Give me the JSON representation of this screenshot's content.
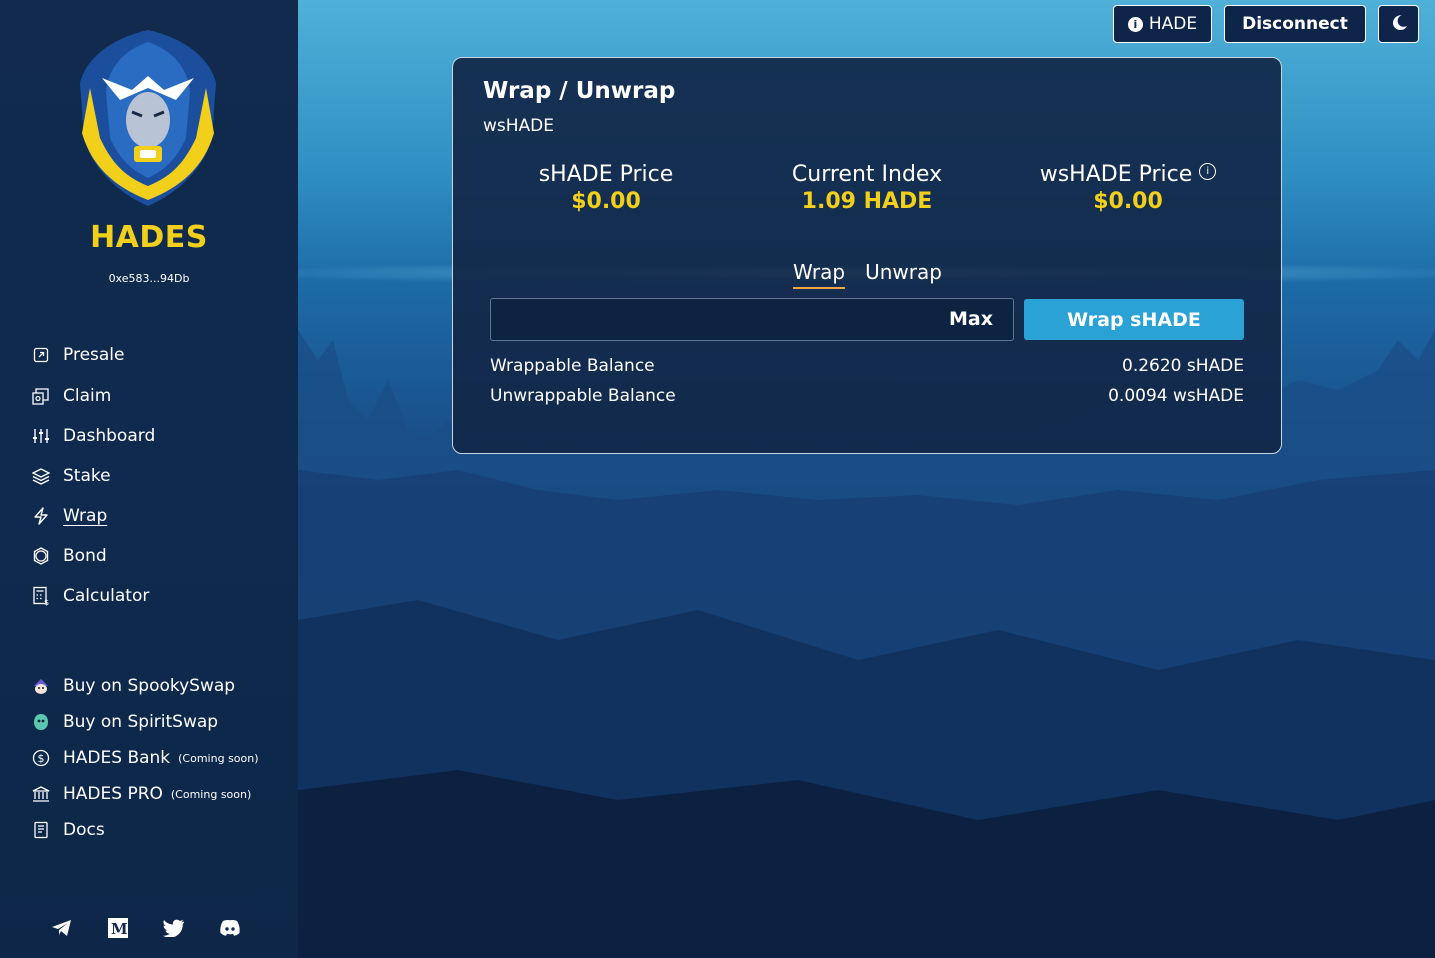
{
  "sidebar": {
    "brand": "HADES",
    "address": "0xe583...94Db",
    "nav": [
      {
        "label": "Presale",
        "icon": "external-link-icon"
      },
      {
        "label": "Claim",
        "icon": "claim-icon"
      },
      {
        "label": "Dashboard",
        "icon": "sliders-icon"
      },
      {
        "label": "Stake",
        "icon": "layers-icon"
      },
      {
        "label": "Wrap",
        "icon": "lightning-icon",
        "active": true
      },
      {
        "label": "Bond",
        "icon": "bond-icon"
      },
      {
        "label": "Calculator",
        "icon": "calculator-icon"
      }
    ],
    "links": [
      {
        "label": "Buy on SpookySwap",
        "icon": "spookyswap-icon"
      },
      {
        "label": "Buy on SpiritSwap",
        "icon": "spiritswap-icon"
      },
      {
        "label": "HADES Bank",
        "note": "(Coming soon)",
        "icon": "dollar-circle-icon"
      },
      {
        "label": "HADES PRO",
        "note": "(Coming soon)",
        "icon": "bank-icon"
      },
      {
        "label": "Docs",
        "icon": "docs-icon"
      }
    ],
    "socials": [
      "telegram-icon",
      "medium-icon",
      "twitter-icon",
      "discord-icon"
    ]
  },
  "topbar": {
    "token_label": "HADE",
    "disconnect_label": "Disconnect",
    "theme_icon": "moon-icon"
  },
  "card": {
    "title": "Wrap / Unwrap",
    "subtitle": "wsHADE",
    "metrics": [
      {
        "label": "sHADE Price",
        "value": "$0.00"
      },
      {
        "label": "Current Index",
        "value": "1.09 HADE"
      },
      {
        "label": "wsHADE Price",
        "value": "$0.00"
      }
    ],
    "tabs": [
      "Wrap",
      "Unwrap"
    ],
    "input": {
      "value": "",
      "placeholder": ""
    },
    "max_label": "Max",
    "action_label": "Wrap sHADE",
    "balances": [
      {
        "label": "Wrappable Balance",
        "value": "0.2620 sHADE"
      },
      {
        "label": "Unwrappable Balance",
        "value": "0.0094 wsHADE"
      }
    ]
  },
  "colors": {
    "accent_yellow": "#f2cf1b",
    "button_blue": "#2aa2d6",
    "tab_underline": "#f0a640",
    "sidebar_bg": "#112a4d"
  }
}
